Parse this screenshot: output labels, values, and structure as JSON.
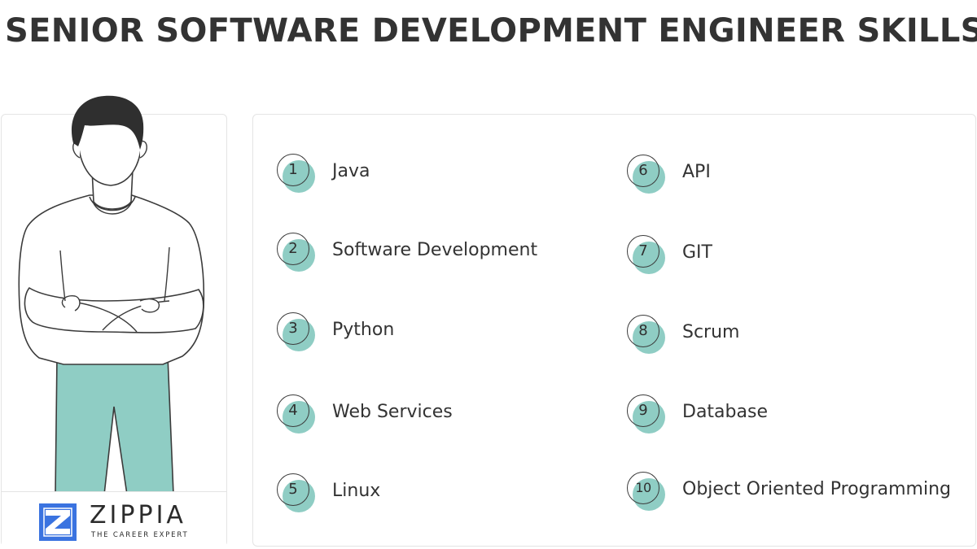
{
  "title": "SENIOR SOFTWARE DEVELOPMENT ENGINEER SKILLS",
  "brand": {
    "name": "ZIPPIA",
    "tagline": "THE CAREER EXPERT",
    "accent_color": "#3a73e0"
  },
  "colors": {
    "badge_fill": "#8fcdc4",
    "pants": "#8fcdc4",
    "text": "#333333"
  },
  "skills": [
    {
      "number": "1",
      "label": "Java"
    },
    {
      "number": "2",
      "label": "Software Development"
    },
    {
      "number": "3",
      "label": "Python"
    },
    {
      "number": "4",
      "label": "Web Services"
    },
    {
      "number": "5",
      "label": "Linux"
    },
    {
      "number": "6",
      "label": "API"
    },
    {
      "number": "7",
      "label": "GIT"
    },
    {
      "number": "8",
      "label": "Scrum"
    },
    {
      "number": "9",
      "label": "Database"
    },
    {
      "number": "10",
      "label": "Object Oriented Programming"
    }
  ]
}
